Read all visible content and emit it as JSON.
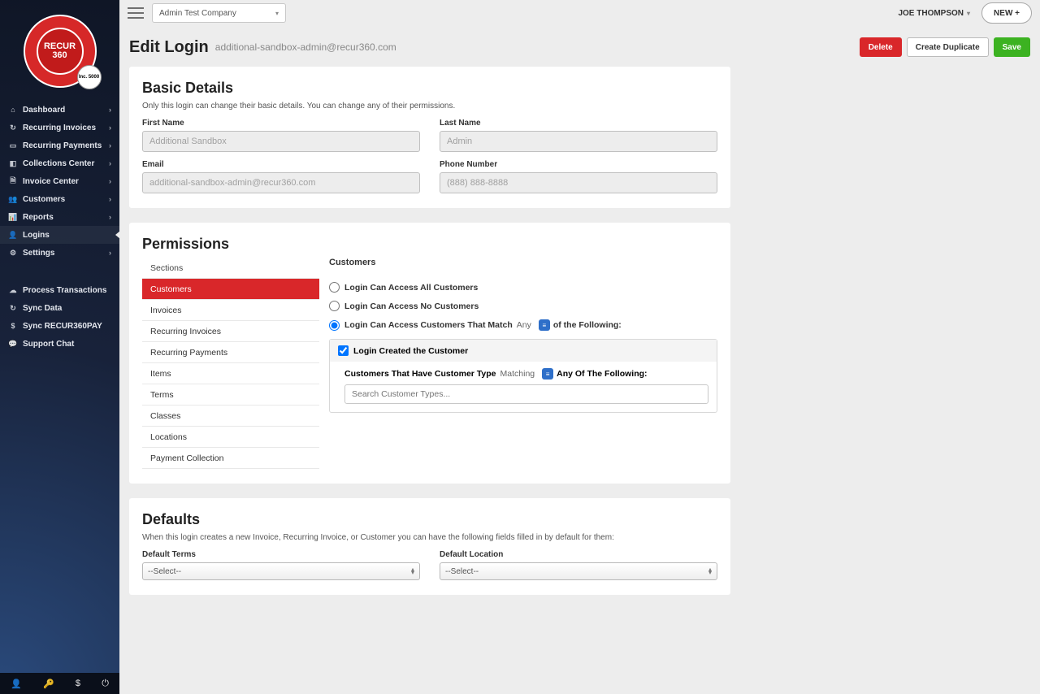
{
  "topbar": {
    "company": "Admin Test Company",
    "user": "JOE THOMPSON",
    "newBtn": "NEW +"
  },
  "logo": {
    "line1": "RECUR",
    "line2": "360",
    "badge": "Inc.\n5000"
  },
  "nav": {
    "main": [
      {
        "icon": "⌂",
        "label": "Dashboard",
        "chev": true
      },
      {
        "icon": "↻",
        "label": "Recurring Invoices",
        "chev": true
      },
      {
        "icon": "▭",
        "label": "Recurring Payments",
        "chev": true
      },
      {
        "icon": "◧",
        "label": "Collections Center",
        "chev": true
      },
      {
        "icon": "🗎",
        "label": "Invoice Center",
        "chev": true
      },
      {
        "icon": "👥",
        "label": "Customers",
        "chev": true
      },
      {
        "icon": "📊",
        "label": "Reports",
        "chev": true
      },
      {
        "icon": "👤",
        "label": "Logins",
        "chev": false,
        "active": true
      },
      {
        "icon": "⚙",
        "label": "Settings",
        "chev": true
      }
    ],
    "secondary": [
      {
        "icon": "☁",
        "label": "Process Transactions"
      },
      {
        "icon": "↻",
        "label": "Sync Data"
      },
      {
        "icon": "$",
        "label": "Sync RECUR360PAY"
      },
      {
        "icon": "💬",
        "label": "Support Chat"
      }
    ]
  },
  "title": {
    "main": "Edit Login",
    "sub": "additional-sandbox-admin@recur360.com"
  },
  "buttons": {
    "delete": "Delete",
    "duplicate": "Create Duplicate",
    "save": "Save"
  },
  "basic": {
    "heading": "Basic Details",
    "desc": "Only this login can change their basic details. You can change any of their permissions.",
    "labels": {
      "first": "First Name",
      "last": "Last Name",
      "email": "Email",
      "phone": "Phone Number"
    },
    "values": {
      "first": "Additional Sandbox",
      "last": "Admin",
      "email": "additional-sandbox-admin@recur360.com",
      "phone": "(888) 888-8888"
    }
  },
  "permissions": {
    "heading": "Permissions",
    "tabsHeader": "Sections",
    "tabs": [
      "Customers",
      "Invoices",
      "Recurring Invoices",
      "Recurring Payments",
      "Items",
      "Terms",
      "Classes",
      "Locations",
      "Payment Collection"
    ],
    "activeTab": "Customers",
    "contentHeading": "Customers",
    "radios": {
      "all": "Login Can Access All Customers",
      "none": "Login Can Access No Customers",
      "matchPrefix": "Login Can Access Customers That Match",
      "matchAny": "Any",
      "matchToggle": "≡",
      "matchSuffix": "of the Following:"
    },
    "filter": {
      "check1": "Login Created the Customer",
      "typePrefix": "Customers That Have Customer Type",
      "matching": "Matching",
      "toggle": "≡",
      "anyof": "Any Of The Following:",
      "searchPlaceholder": "Search Customer Types..."
    }
  },
  "defaults": {
    "heading": "Defaults",
    "desc": "When this login creates a new Invoice, Recurring Invoice, or Customer you can have the following fields filled in by default for them:",
    "labels": {
      "terms": "Default Terms",
      "location": "Default Location"
    },
    "values": {
      "terms": "--Select--",
      "location": "--Select--"
    }
  }
}
